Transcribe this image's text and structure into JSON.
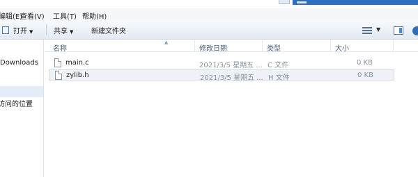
{
  "menu": [
    {
      "label": "编辑(E)"
    },
    {
      "label": "查看(V)"
    },
    {
      "label": "工具(T)"
    },
    {
      "label": "帮助(H)"
    }
  ],
  "toolbar": {
    "open_label": "打开",
    "share_label": "共享",
    "new_folder_label": "新建文件夹",
    "caret": "▼"
  },
  "nav": {
    "items": [
      {
        "label": "Downloads"
      },
      {
        "label": "访问的位置"
      }
    ]
  },
  "columns": {
    "name": "名称",
    "date": "修改日期",
    "type": "类型",
    "size": "大小"
  },
  "files": [
    {
      "name": "main.c",
      "date": "2021/3/5 星期五 ...",
      "type": "C 文件",
      "size": "0 KB",
      "icon": "c-file-icon"
    },
    {
      "name": "zylib.h",
      "date": "2021/3/5 星期五 ...",
      "type": "H 文件",
      "size": "0 KB",
      "icon": "h-file-icon"
    }
  ]
}
